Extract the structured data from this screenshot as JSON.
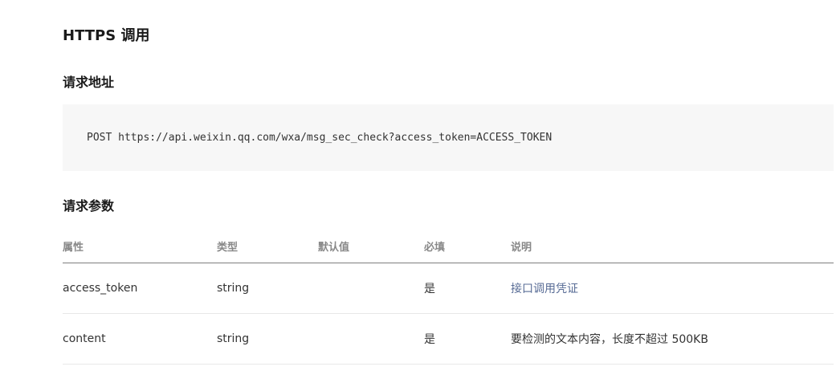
{
  "section_title": "HTTPS 调用",
  "request_url": {
    "heading": "请求地址",
    "code": "POST https://api.weixin.qq.com/wxa/msg_sec_check?access_token=ACCESS_TOKEN"
  },
  "request_params": {
    "heading": "请求参数",
    "columns": {
      "name": "属性",
      "type": "类型",
      "default": "默认值",
      "required": "必填",
      "description": "说明"
    },
    "rows": [
      {
        "name": "access_token",
        "type": "string",
        "default": "",
        "required": "是",
        "description": "接口调用凭证"
      },
      {
        "name": "content",
        "type": "string",
        "default": "",
        "required": "是",
        "description": "要检测的文本内容，长度不超过 500KB"
      }
    ]
  },
  "colors": {
    "link": "#576b95",
    "code_background": "#f7f7f7",
    "header_text": "#888888"
  }
}
